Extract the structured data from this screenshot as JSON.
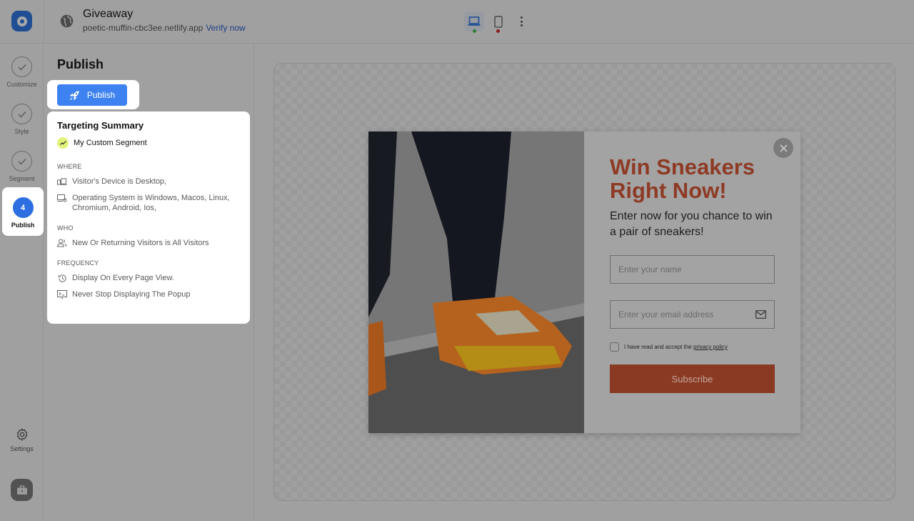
{
  "topbar": {
    "title": "Giveaway",
    "url": "poetic-muffin-cbc3ee.netlify.app",
    "verify_label": "Verify now",
    "devices": [
      {
        "name": "desktop",
        "active": true,
        "status_color": "#2e7d33"
      },
      {
        "name": "mobile",
        "active": false,
        "status_color": "#8b1a1a"
      }
    ]
  },
  "rail": {
    "steps": [
      {
        "label": "Customize",
        "state": "done"
      },
      {
        "label": "Style",
        "state": "done"
      },
      {
        "label": "Segment",
        "state": "done"
      },
      {
        "label": "Publish",
        "state": "active",
        "number": "4"
      }
    ],
    "settings_label": "Settings"
  },
  "panel": {
    "title": "Publish",
    "publish_button": "Publish",
    "summary": {
      "title": "Targeting Summary",
      "segment": "My Custom Segment",
      "where_label": "WHERE",
      "where": [
        "Visitor's Device is Desktop,",
        "Operating System is Windows, Macos, Linux, Chromium, Android, Ios,"
      ],
      "who_label": "WHO",
      "who": [
        "New Or Returning Visitors is All Visitors"
      ],
      "frequency_label": "FREQUENCY",
      "frequency": [
        "Display On Every Page View.",
        "Never Stop Displaying The Popup"
      ]
    }
  },
  "popup": {
    "headline": "Win Sneakers Right Now!",
    "subhead": "Enter now for you chance to win a pair of sneakers!",
    "name_placeholder": "Enter your name",
    "email_placeholder": "Enter your email address",
    "consent_text": "I have read and accept the ",
    "consent_link": "privacy policy",
    "subscribe_label": "Subscribe",
    "accent_color": "#8e3a24"
  }
}
